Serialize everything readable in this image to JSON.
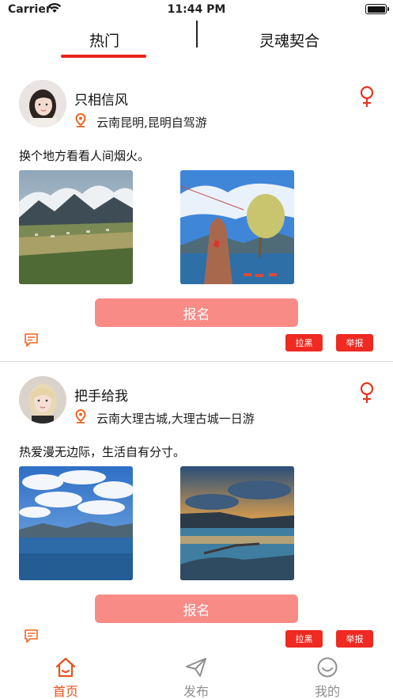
{
  "status_bar": {
    "carrier": "Carrier",
    "time": "11:44 PM",
    "battery_level": 1.0
  },
  "top_tabs": [
    {
      "label": "热门",
      "active": true
    },
    {
      "label": "灵魂契合",
      "active": false
    }
  ],
  "accent_color": "#e8231e",
  "posts": [
    {
      "username": "只相信风",
      "gender_icon": "female-icon",
      "location": "云南昆明,昆明自驾游",
      "text": "换个地方看看人间烟火。",
      "photos": [
        "mountain-valley-village",
        "rock-lake-prayer-flags"
      ],
      "signup_label": "报名",
      "block_label": "拉黑",
      "report_label": "举报"
    },
    {
      "username": "把手给我",
      "gender_icon": "female-icon",
      "location": "云南大理古城,大理古城一日游",
      "text": "热爱漫无边际，生活自有分寸。",
      "photos": [
        "blue-sky-lake",
        "sunset-lake"
      ],
      "signup_label": "报名",
      "block_label": "拉黑",
      "report_label": "举报"
    }
  ],
  "tab_bar": {
    "items": [
      {
        "label": "首页",
        "icon": "home-icon",
        "active": true
      },
      {
        "label": "发布",
        "icon": "paper-plane-icon",
        "active": false
      },
      {
        "label": "我的",
        "icon": "smiley-face-icon",
        "active": false
      }
    ]
  }
}
